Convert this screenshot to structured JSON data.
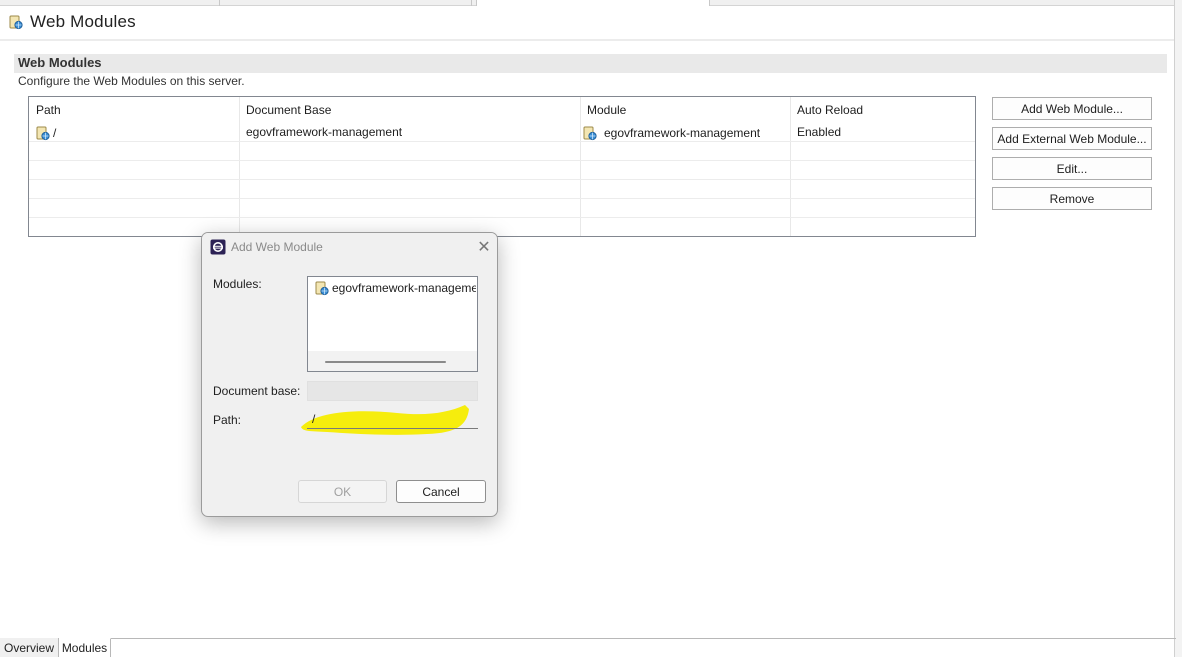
{
  "editor": {
    "title": "Web Modules",
    "title_icon": "web-module-icon"
  },
  "section": {
    "title": "Web Modules",
    "description": "Configure the Web Modules on this server."
  },
  "table": {
    "columns": [
      "Path",
      "Document Base",
      "Module",
      "Auto Reload"
    ],
    "rows": [
      {
        "path": "/",
        "document_base": "egovframework-management",
        "module": "egovframework-management",
        "auto_reload": "Enabled"
      }
    ]
  },
  "buttons": {
    "add_web_module": "Add Web Module...",
    "add_external": "Add External Web Module...",
    "edit": "Edit...",
    "remove": "Remove"
  },
  "bottom_tabs": [
    "Overview",
    "Modules"
  ],
  "active_bottom_tab": "Modules",
  "dialog": {
    "title": "Add Web Module",
    "modules_label": "Modules:",
    "modules": [
      "egovframework-management"
    ],
    "document_base_label": "Document base:",
    "document_base_value": "",
    "path_label": "Path:",
    "path_value": "/",
    "ok": "OK",
    "cancel": "Cancel",
    "ok_enabled": false,
    "highlight_color": "#f5ec00"
  }
}
